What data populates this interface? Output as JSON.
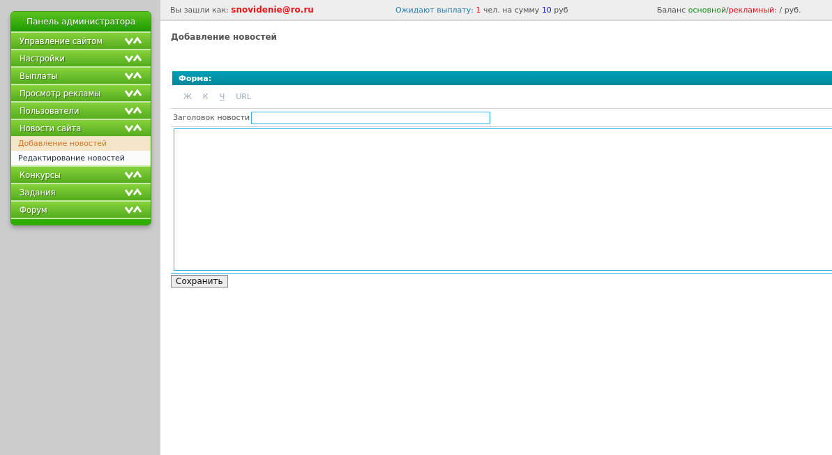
{
  "sidebar": {
    "title": "Панель администратора",
    "items": [
      {
        "label": "Управление сайтом"
      },
      {
        "label": "Настройки"
      },
      {
        "label": "Выплаты"
      },
      {
        "label": "Просмотр рекламы"
      },
      {
        "label": "Пользователи"
      },
      {
        "label": "Новости сайта",
        "children": [
          {
            "label": "Добавление новостей",
            "selected": true
          },
          {
            "label": "Редактирование новостей",
            "selected": false
          }
        ]
      },
      {
        "label": "Конкурсы"
      },
      {
        "label": "Задания"
      },
      {
        "label": "Форум"
      }
    ]
  },
  "top_bar": [
    {
      "kind": "login",
      "parts": [
        {
          "kind": "label",
          "text": "Вы зашли как: "
        },
        {
          "kind": "user",
          "text": "snovidenie@ro.ru"
        }
      ]
    },
    {
      "kind": "payouts",
      "parts": [
        {
          "kind": "link",
          "text": "Ожидают выплату: "
        },
        {
          "kind": "count",
          "text": "1"
        },
        {
          "kind": "label",
          "text": " чел. на сумму "
        },
        {
          "kind": "sum",
          "text": "10"
        },
        {
          "kind": "label",
          "text": " руб"
        }
      ]
    },
    {
      "kind": "balance",
      "parts": [
        {
          "kind": "label",
          "text": "Баланс "
        },
        {
          "kind": "main",
          "text": "основной"
        },
        {
          "kind": "label",
          "text": "/"
        },
        {
          "kind": "ad",
          "text": "рекламный:"
        },
        {
          "kind": "label",
          "text": " / руб."
        }
      ]
    }
  ],
  "page_title": "Добавление новостей",
  "form": {
    "title": "Форма:",
    "toolbar": [
      {
        "kind": "bold",
        "label": "Ж"
      },
      {
        "kind": "italic",
        "label": "К"
      },
      {
        "kind": "underline",
        "label": "Ч"
      },
      {
        "kind": "link",
        "label": "URL"
      }
    ],
    "fields": [
      {
        "label": "Заголовок новости"
      }
    ],
    "save_button": "Сохранить"
  }
}
